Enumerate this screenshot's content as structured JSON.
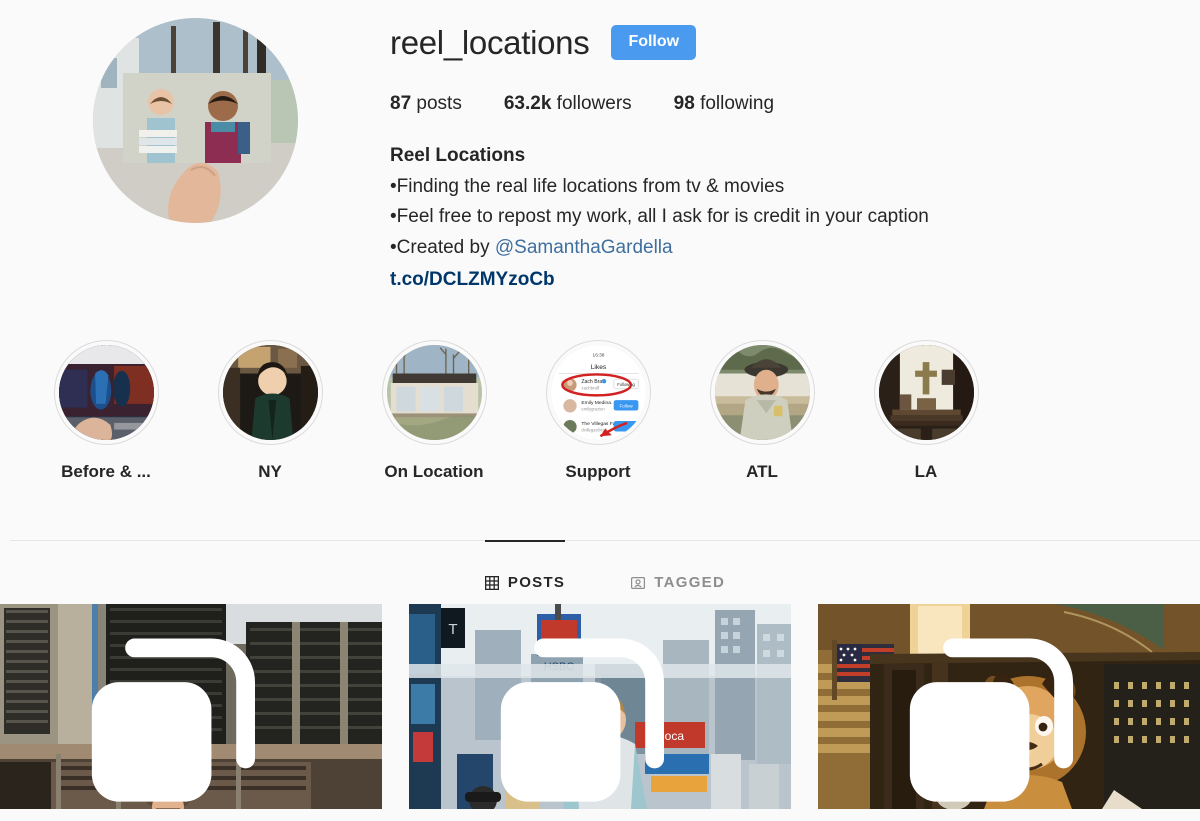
{
  "profile": {
    "username": "reel_locations",
    "follow_label": "Follow",
    "stats": [
      {
        "value": "87",
        "label": "posts"
      },
      {
        "value": "63.2k",
        "label": "followers"
      },
      {
        "value": "98",
        "label": "following"
      }
    ],
    "full_name": "Reel Locations",
    "bio_lines": [
      "•Finding the real life locations from tv & movies",
      "•Feel free to repost my work, all I ask for is credit in your caption"
    ],
    "bio_created_prefix": "•Created by ",
    "bio_mention": "@SamanthaGardella",
    "external_link": "t.co/DCLZMYzoCb",
    "avatar_icon": "profile-photo"
  },
  "highlights": [
    {
      "label": "Before & ...",
      "icon": "highlight-cover-before-after"
    },
    {
      "label": "NY",
      "icon": "highlight-cover-ny"
    },
    {
      "label": "On Location",
      "icon": "highlight-cover-on-location"
    },
    {
      "label": "Support",
      "icon": "highlight-cover-support"
    },
    {
      "label": "ATL",
      "icon": "highlight-cover-atl"
    },
    {
      "label": "LA",
      "icon": "highlight-cover-la"
    }
  ],
  "tabs": [
    {
      "label": "POSTS",
      "icon": "grid-icon",
      "active": true
    },
    {
      "label": "TAGGED",
      "icon": "tagged-person-icon",
      "active": false
    }
  ],
  "posts": [
    {
      "name": "post-brutalist-building",
      "multi": true
    },
    {
      "name": "post-times-square",
      "multi": true
    },
    {
      "name": "post-grand-central-lion",
      "multi": true
    }
  ],
  "colors": {
    "accent_blue": "#4a9bef",
    "link_navy": "#00376b",
    "mention_blue": "#3f6f9e",
    "background": "#fafafa",
    "text": "#262626",
    "muted": "#8e8e8e"
  }
}
